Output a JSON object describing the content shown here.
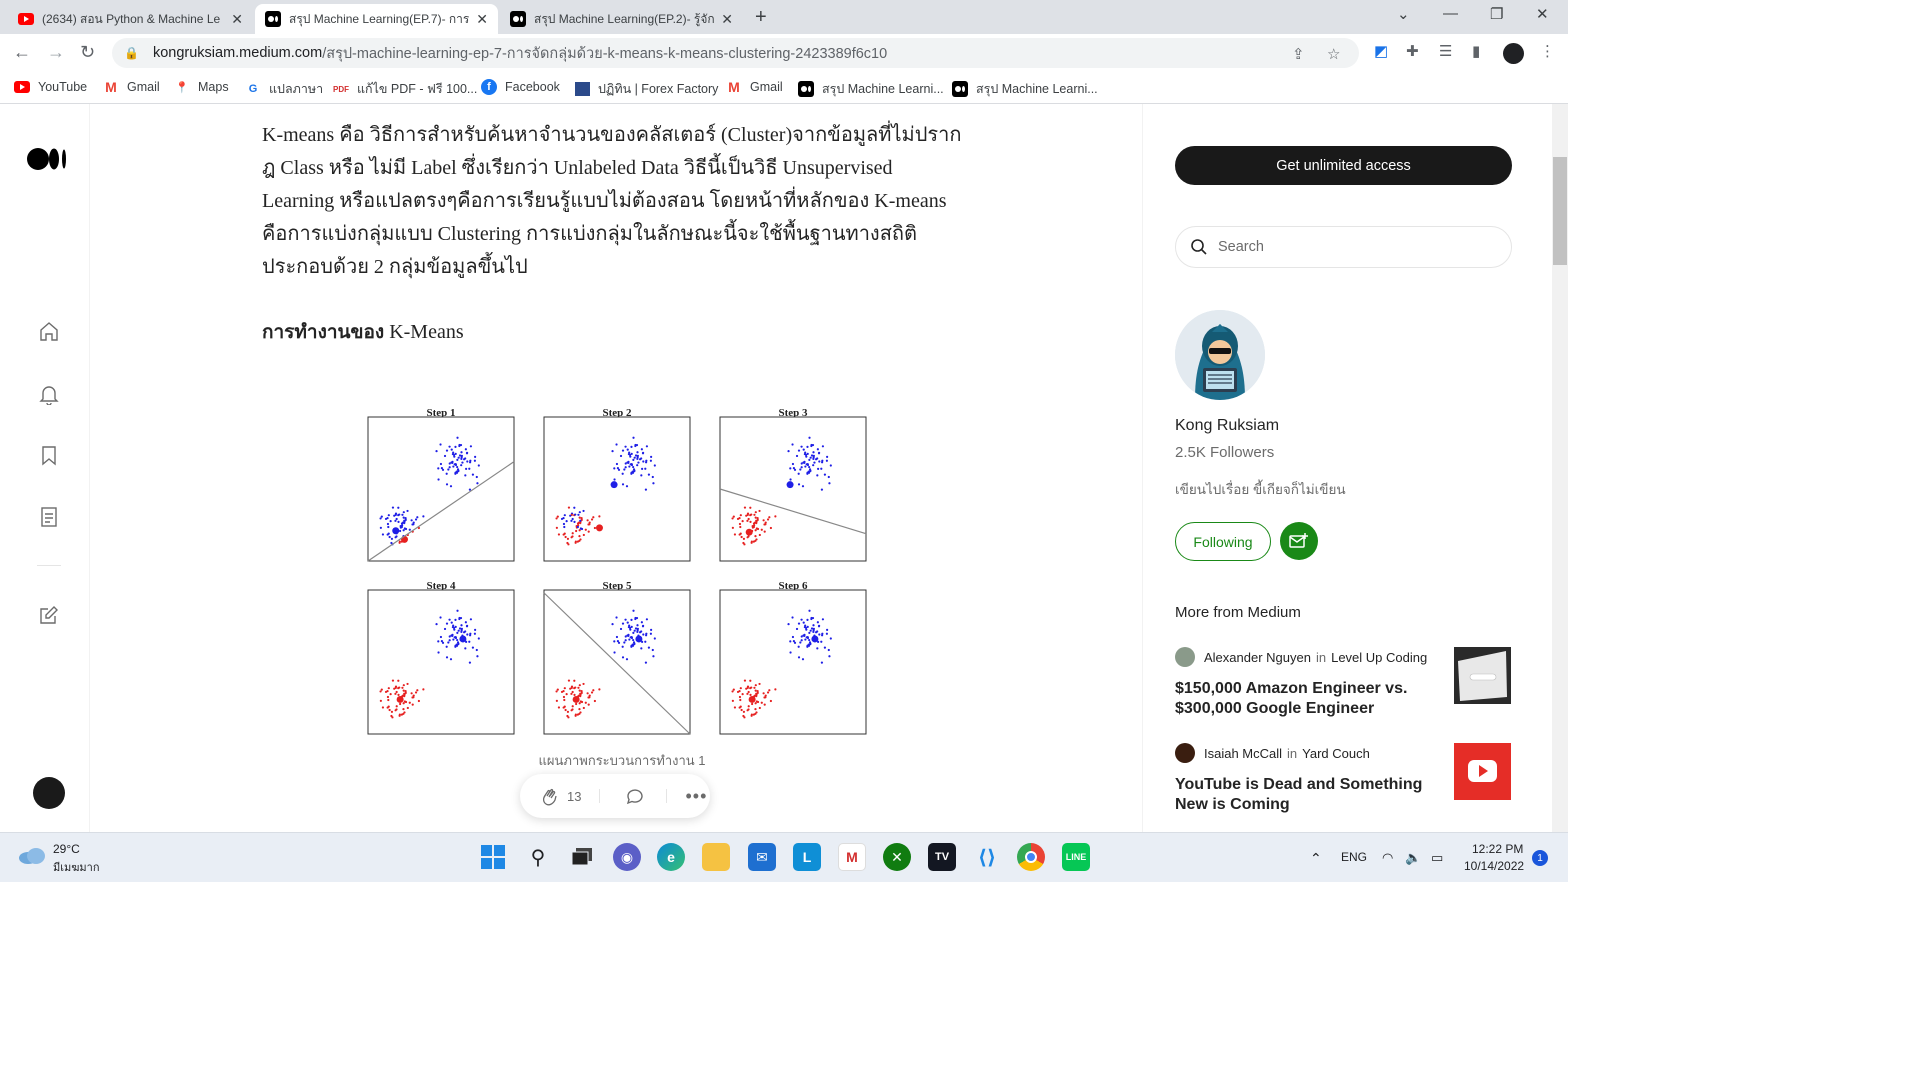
{
  "browser": {
    "tabs": [
      {
        "title": "(2634) สอน Python & Machine Le",
        "favicon": "youtube-icon",
        "active": false
      },
      {
        "title": "สรุป Machine Learning(EP.7)- การ",
        "favicon": "medium-icon",
        "active": true
      },
      {
        "title": "สรุป Machine Learning(EP.2)- รู้จัก",
        "favicon": "medium-icon",
        "active": false
      }
    ],
    "url_host": "kongruksiam.medium.com",
    "url_path": "/สรุป-machine-learning-ep-7-การจัดกลุ่มด้วย-k-means-k-means-clustering-2423389f6c10",
    "bookmarks": [
      {
        "label": "YouTube",
        "icon": "youtube-icon"
      },
      {
        "label": "Gmail",
        "icon": "gmail-icon"
      },
      {
        "label": "Maps",
        "icon": "maps-icon"
      },
      {
        "label": "แปลภาษา",
        "icon": "translate-icon"
      },
      {
        "label": "แก้ไข PDF - ฟรี 100...",
        "icon": "pdf-icon"
      },
      {
        "label": "Facebook",
        "icon": "facebook-icon"
      },
      {
        "label": "ปฏิทิน | Forex Factory",
        "icon": "calendar-icon"
      },
      {
        "label": "Gmail",
        "icon": "gmail-icon"
      },
      {
        "label": "สรุป Machine Learni...",
        "icon": "medium-icon"
      },
      {
        "label": "สรุป Machine Learni...",
        "icon": "medium-icon"
      }
    ]
  },
  "article": {
    "paragraph": "K-means คือ วิธีการสำหรับค้นหาจำนวนของคลัสเตอร์ (Cluster)จากข้อมูลที่ไม่ปรากฎ Class หรือ ไม่มี Label ซึ่งเรียกว่า Unlabeled Data วิธีนี้เป็นวิธี Unsupervised Learning หรือแปลตรงๆคือการเรียนรู้แบบไม่ต้องสอน โดยหน้าที่หลักของ K-means คือการแบ่งกลุ่มแบบ Clustering การแบ่งกลุ่มในลักษณะนี้จะใช้พื้นฐานทางสถิติ ประกอบด้วย 2 กลุ่มข้อมูลขึ้นไป",
    "heading_thai": "การทำงานของ",
    "heading_en": "K-Means",
    "figure_steps": [
      "Step 1",
      "Step 2",
      "Step 3",
      "Step 4",
      "Step 5",
      "Step 6"
    ],
    "caption": "แผนภาพกระบวนการทำงาน 1",
    "clap_count": "13"
  },
  "sidebar": {
    "get_access": "Get unlimited access",
    "search_placeholder": "Search",
    "author_name": "Kong Ruksiam",
    "followers": "2.5K Followers",
    "bio": "เขียนไปเรื่อย ขี้เกียจก็ไม่เขียน",
    "follow_label": "Following",
    "more_header": "More from Medium",
    "recommendations": [
      {
        "author": "Alexander Nguyen",
        "in": "in",
        "publication": "Level Up Coding",
        "title": "$150,000 Amazon Engineer vs. $300,000 Google Engineer"
      },
      {
        "author": "Isaiah McCall",
        "in": "in",
        "publication": "Yard Couch",
        "title": "YouTube is Dead and Something New is Coming"
      }
    ]
  },
  "taskbar": {
    "weather_temp": "29°C",
    "weather_desc": "มีเมฆมาก",
    "language": "ENG",
    "time": "12:22 PM",
    "date": "10/14/2022",
    "notification_count": "1"
  },
  "colors": {
    "accent_green": "#1a8917",
    "cluster_blue": "#1f1fe6",
    "cluster_red": "#e62020"
  }
}
